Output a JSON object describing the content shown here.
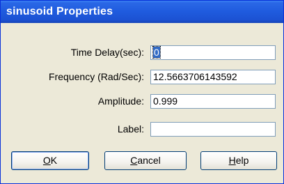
{
  "window": {
    "title": "sinusoid Properties"
  },
  "fields": {
    "time_delay": {
      "label": "Time Delay(sec):",
      "value": "0"
    },
    "frequency": {
      "label": "Frequency (Rad/Sec):",
      "value": "12.5663706143592"
    },
    "amplitude": {
      "label": "Amplitude:",
      "value": "0.999"
    },
    "label": {
      "label": "Label:",
      "value": ""
    }
  },
  "buttons": {
    "ok": {
      "mnemonic": "O",
      "rest": "K"
    },
    "cancel": {
      "mnemonic": "C",
      "rest": "ancel"
    },
    "help": {
      "mnemonic": "H",
      "rest": "elp"
    }
  }
}
